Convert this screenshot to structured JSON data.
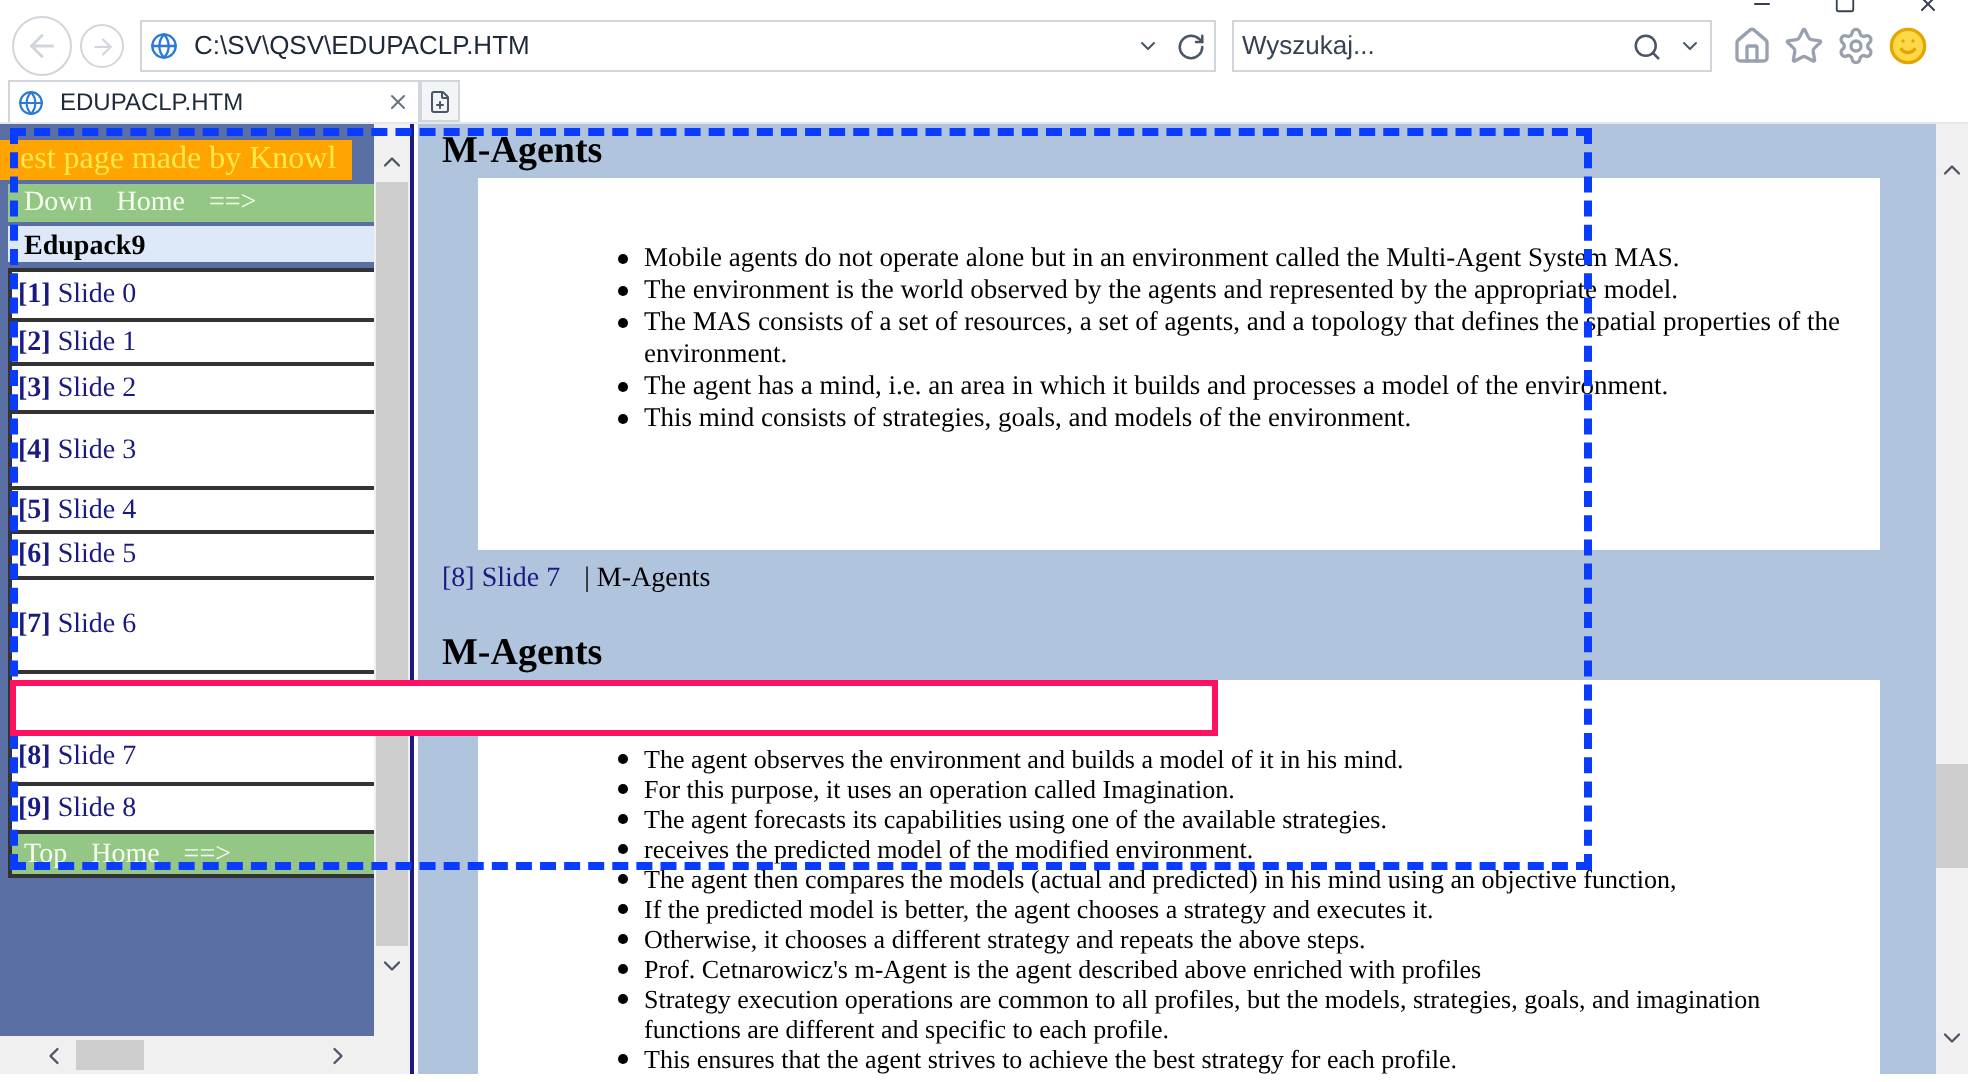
{
  "address_bar": {
    "value": "C:\\SV\\QSV\\EDUPACLP.HTM"
  },
  "search": {
    "placeholder": "Wyszukaj..."
  },
  "tabs": [
    {
      "label": "EDUPACLP.HTM",
      "selected": true
    }
  ],
  "sidebar": {
    "banner": "est page made by Knowl",
    "top_nav": [
      "Down",
      "Home",
      "==>"
    ],
    "title": "Edupack9",
    "items": [
      {
        "label": "**[1]** Slide 0"
      },
      {
        "label": "**[2]** Slide 1"
      },
      {
        "label": "**[3]** Slide 2"
      },
      {
        "label": "**[4]** Slide 3"
      },
      {
        "label": "**[5]** Slide 4"
      },
      {
        "label": "**[6]** Slide 5"
      },
      {
        "label": "**[7]** Slide 6"
      },
      {
        "label": "**[8]** Slide 7"
      },
      {
        "label": "**[9]** Slide 8"
      }
    ],
    "bottom_nav": [
      "Top",
      "Home",
      "==>"
    ]
  },
  "sections": [
    {
      "heading": "M-Agents",
      "bullets": [
        "Mobile agents do not operate alone but in an environment called the Multi-Agent System MAS.",
        "The environment is the world observed by the agents and represented by the appropriate model.",
        "The MAS consists of a set of resources, a set of agents, and a topology that defines the spatial properties of the environment.",
        "The agent has a mind, i.e. an area in which it builds and processes a model of the environment.",
        "This mind consists of strategies, goals, and models of the environment."
      ],
      "footer_link": "[8] Slide 7",
      "footer_text": "| M-Agents"
    },
    {
      "heading": "M-Agents",
      "bullets": [
        "The agent observes the environment and builds a model of it in his mind.",
        "For this purpose, it uses an operation called Imagination.",
        "The agent forecasts its capabilities using one of the available strategies.",
        "receives the predicted model of the modified environment.",
        "The agent then compares the models (actual and predicted) in his mind using an objective function,",
        "If the predicted model is better, the agent chooses a strategy and executes it.",
        "Otherwise, it chooses a different strategy and repeats the above steps.",
        "Prof. Cetnarowicz's m-Agent is the agent described above enriched with profiles",
        "Strategy execution operations are common to all profiles, but the models, strategies, goals, and imagination functions are different and specific to each profile.",
        "This ensures that the agent strives to achieve the best strategy for each profile."
      ]
    }
  ]
}
